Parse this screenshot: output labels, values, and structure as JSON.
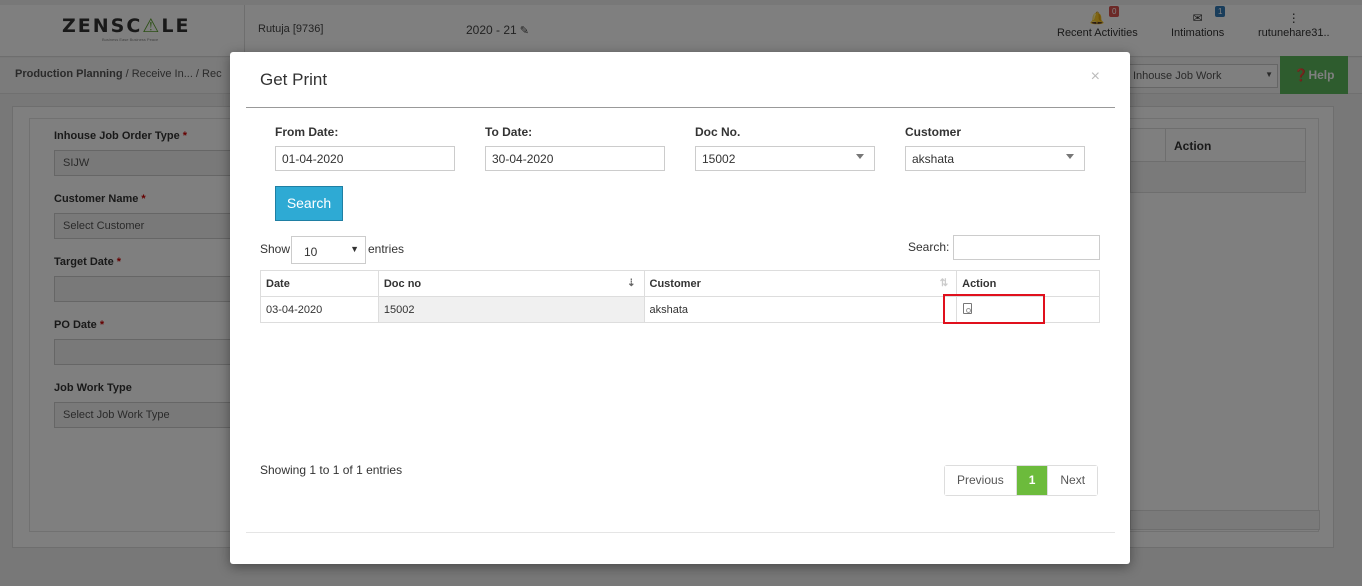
{
  "app": {
    "logo_text_left": "ZENSC",
    "logo_text_accent": "⚠",
    "logo_text_right": "LE",
    "logo_tagline": "Business Ease Business Peace",
    "user": "Rutuja [9736]",
    "financial_year": "2020 - 21",
    "recent_activities": {
      "label": "Recent Activities",
      "badge": "0"
    },
    "intimations": {
      "label": "Intimations",
      "badge": "1"
    },
    "account": "rutunehare31..",
    "breadcrumb_main": "Production Planning",
    "breadcrumb_rest": " / Receive In... / Rec",
    "type_select": "Inhouse Job Work",
    "help_label": "Help",
    "form": {
      "order_type_label": "Inhouse Job Order Type",
      "order_type_value": "SIJW",
      "customer_label": "Customer Name",
      "customer_placeholder": "Select Customer",
      "target_date_label": "Target Date",
      "po_date_label": "PO Date",
      "job_work_label": "Job Work Type",
      "job_work_placeholder": "Select Job Work Type",
      "required_mark": "*"
    },
    "bg_table_action": "Action"
  },
  "modal": {
    "title": "Get Print",
    "close": "×",
    "from_date_label": "From Date:",
    "from_date": "01-04-2020",
    "to_date_label": "To Date:",
    "to_date": "30-04-2020",
    "doc_no_label": "Doc No.",
    "doc_no": "15002",
    "customer_label": "Customer",
    "customer": "akshata",
    "search_button": "Search",
    "show_label": "Show",
    "page_length": "10",
    "entries_label": "entries",
    "search_label": "Search:",
    "table": {
      "headers": [
        "Date",
        "Doc no",
        "Customer",
        "Action"
      ],
      "rows": [
        {
          "date": "03-04-2020",
          "doc_no": "15002",
          "customer": "akshata"
        }
      ]
    },
    "info": "Showing 1 to 1 of 1 entries",
    "pagination": {
      "previous": "Previous",
      "current": "1",
      "next": "Next"
    }
  }
}
